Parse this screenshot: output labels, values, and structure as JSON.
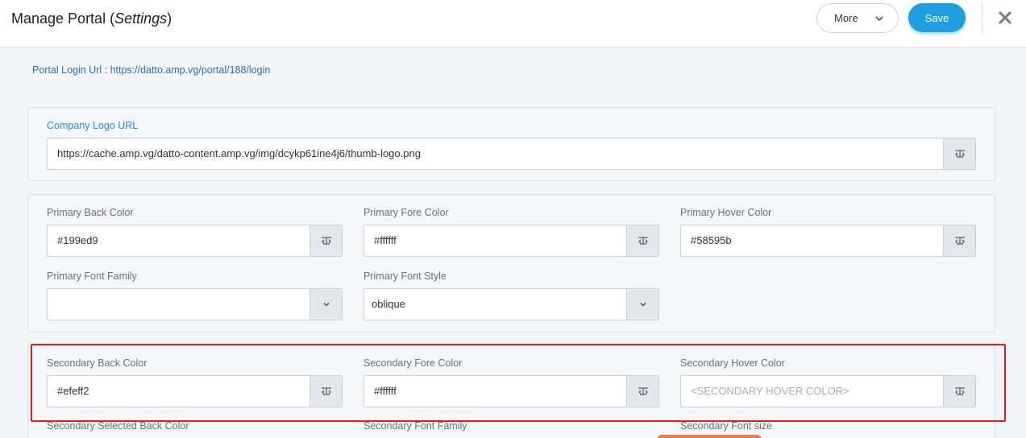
{
  "header": {
    "title_main": "Manage Portal (",
    "title_italic": "Settings",
    "title_close": ")",
    "more_label": "More",
    "save_label": "Save"
  },
  "portal_login": {
    "text": "Portal Login Url : https://datto.amp.vg/portal/188/login"
  },
  "company_logo": {
    "label": "Company Logo URL",
    "value": "https://cache.amp.vg/datto-content.amp.vg/img/dcykp61ine4j6/thumb-logo.png"
  },
  "primary": {
    "back_color_label": "Primary Back Color",
    "back_color_value": "#199ed9",
    "fore_color_label": "Primary Fore Color",
    "fore_color_value": "#ffffff",
    "hover_color_label": "Primary Hover Color",
    "hover_color_value": "#58595b",
    "font_family_label": "Primary Font Family",
    "font_family_value": "",
    "font_style_label": "Primary Font Style",
    "font_style_value": "oblique"
  },
  "secondary": {
    "back_color_label": "Secondary Back Color",
    "back_color_value": "#efeff2",
    "fore_color_label": "Secondary Fore Color",
    "fore_color_value": "#ffffff",
    "hover_color_label": "Secondary Hover Color",
    "hover_color_placeholder": "<SECONDARY HOVER COLOR>",
    "selected_back_color_label": "Secondary Selected Back Color",
    "font_family_label": "Secondary Font Family",
    "font_size_label": "Secondary Font size"
  },
  "colors": {
    "accent": "#1f9ee0",
    "highlight": "#e31b23",
    "link": "#2c6fae"
  },
  "icons": {
    "more_chevron": "chevron-down-icon",
    "close": "close-icon",
    "field_addon": "text-format-icon",
    "dropdown": "chevron-down-icon"
  }
}
